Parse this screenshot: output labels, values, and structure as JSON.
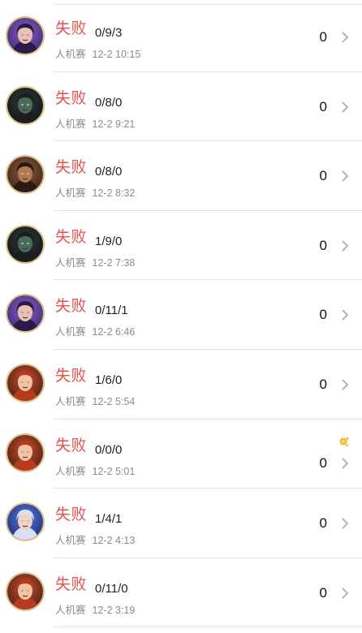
{
  "matches": [
    {
      "result": "失败",
      "kda": "0/9/3",
      "mode": "人机赛",
      "time": "12-2 10:15",
      "score": "0",
      "avatar": "purple",
      "medal": false
    },
    {
      "result": "失败",
      "kda": "0/8/0",
      "mode": "人机赛",
      "time": "12-2 9:21",
      "score": "0",
      "avatar": "dark",
      "medal": false
    },
    {
      "result": "失败",
      "kda": "0/8/0",
      "mode": "人机赛",
      "time": "12-2 8:32",
      "score": "0",
      "avatar": "brown",
      "medal": false
    },
    {
      "result": "失败",
      "kda": "1/9/0",
      "mode": "人机赛",
      "time": "12-2 7:38",
      "score": "0",
      "avatar": "dark",
      "medal": false
    },
    {
      "result": "失败",
      "kda": "0/11/1",
      "mode": "人机赛",
      "time": "12-2 6:46",
      "score": "0",
      "avatar": "purple",
      "medal": false
    },
    {
      "result": "失败",
      "kda": "1/6/0",
      "mode": "人机赛",
      "time": "12-2 5:54",
      "score": "0",
      "avatar": "red",
      "medal": false
    },
    {
      "result": "失败",
      "kda": "0/0/0",
      "mode": "人机赛",
      "time": "12-2 5:01",
      "score": "0",
      "avatar": "red",
      "medal": true
    },
    {
      "result": "失败",
      "kda": "1/4/1",
      "mode": "人机赛",
      "time": "12-2 4:13",
      "score": "0",
      "avatar": "blue",
      "medal": false
    },
    {
      "result": "失败",
      "kda": "0/11/0",
      "mode": "人机赛",
      "time": "12-2 3:19",
      "score": "0",
      "avatar": "red",
      "medal": false
    }
  ],
  "colors": {
    "result_loss": "#e8524d",
    "avatar_ring": "#d9c48c",
    "medal": "#f2b830"
  },
  "icons": {
    "chevron": "chevron-right-icon",
    "medal": "medal-icon"
  }
}
